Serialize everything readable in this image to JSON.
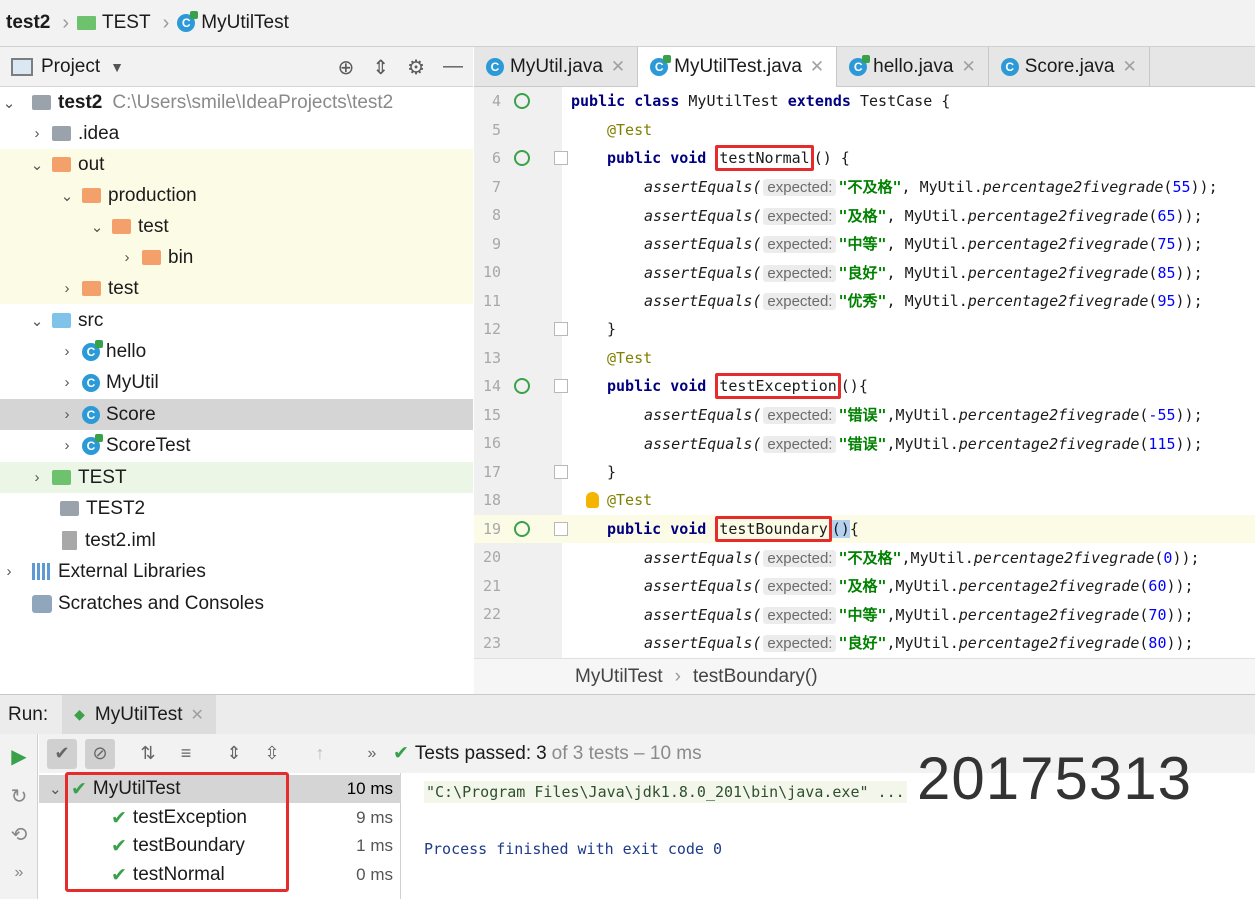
{
  "breadcrumb": {
    "items": [
      "test2",
      "TEST",
      "MyUtilTest"
    ]
  },
  "project_panel": {
    "title": "Project",
    "icons": [
      "target-icon",
      "collapse-icon",
      "gear-icon",
      "minimize-icon"
    ],
    "tree": [
      {
        "label": "test2",
        "extra": "C:\\Users\\smile\\IdeaProjects\\test2"
      },
      {
        "label": ".idea"
      },
      {
        "label": "out"
      },
      {
        "label": "production"
      },
      {
        "label": "test"
      },
      {
        "label": "bin"
      },
      {
        "label": "test"
      },
      {
        "label": "src"
      },
      {
        "label": "hello"
      },
      {
        "label": "MyUtil"
      },
      {
        "label": "Score"
      },
      {
        "label": "ScoreTest"
      },
      {
        "label": "TEST"
      },
      {
        "label": "TEST2"
      },
      {
        "label": "test2.iml"
      },
      {
        "label": "External Libraries"
      },
      {
        "label": "Scratches and Consoles"
      }
    ]
  },
  "tabs": [
    {
      "label": "MyUtil.java"
    },
    {
      "label": "MyUtilTest.java"
    },
    {
      "label": "hello.java"
    },
    {
      "label": "Score.java"
    }
  ],
  "editor": {
    "line_numbers": [
      "4",
      "5",
      "6",
      "7",
      "8",
      "9",
      "10",
      "11",
      "12",
      "13",
      "14",
      "15",
      "16",
      "17",
      "18",
      "19",
      "20",
      "21",
      "22",
      "23"
    ],
    "tokens": {
      "public": "public",
      "class": "class",
      "void": "void",
      "extends": "extends",
      "class_name": "MyUtilTest",
      "super_class": "TestCase",
      "annotation": "@Test",
      "assert": "assertEquals(",
      "hint": "expected:",
      "util": "MyUtil.",
      "method": "percentage2fivegrade",
      "test_normal": "testNormal",
      "test_exception": "testException",
      "test_boundary": "testBoundary"
    },
    "strings": {
      "bujige": "\"不及格\"",
      "jige": "\"及格\"",
      "zhongdeng": "\"中等\"",
      "lianghao": "\"良好\"",
      "youxiu": "\"优秀\"",
      "cuowu": "\"错误\""
    },
    "nums": [
      "55",
      "65",
      "75",
      "85",
      "95",
      "-55",
      "115",
      "0",
      "60",
      "70",
      "80"
    ]
  },
  "editor_breadcrumb": [
    "MyUtilTest",
    "testBoundary()"
  ],
  "run": {
    "label": "Run:",
    "tab": "MyUtilTest",
    "status_prefix": "Tests passed:",
    "status_count": "3",
    "status_suffix": "of 3 tests – 10 ms",
    "tests": [
      {
        "name": "MyUtilTest",
        "duration": "10 ms"
      },
      {
        "name": "testException",
        "duration": "9 ms"
      },
      {
        "name": "testBoundary",
        "duration": "1 ms"
      },
      {
        "name": "testNormal",
        "duration": "0 ms"
      }
    ],
    "console": [
      "\"C:\\Program Files\\Java\\jdk1.8.0_201\\bin\\java.exe\" ...",
      "Process finished with exit code 0"
    ]
  },
  "overlay_number": "20175313"
}
